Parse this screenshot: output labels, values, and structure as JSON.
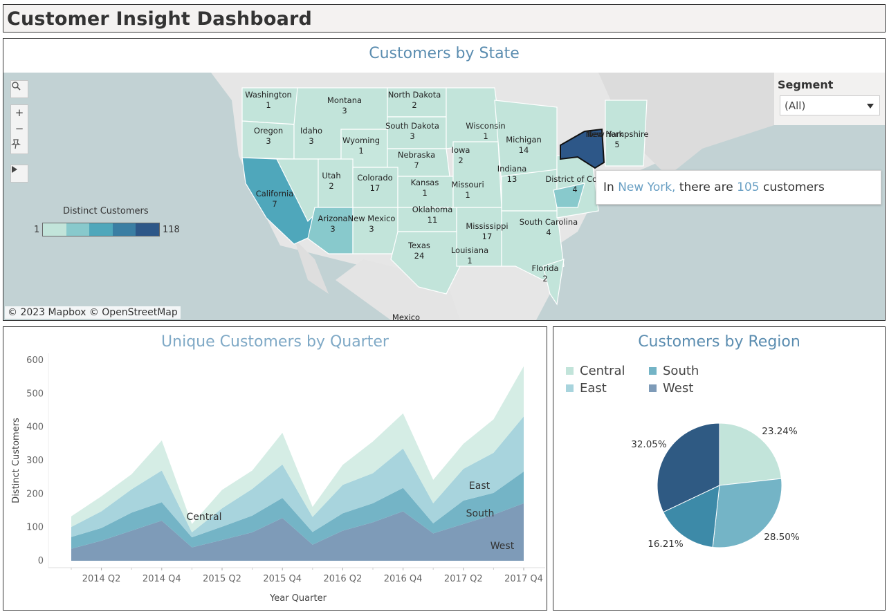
{
  "dashboard": {
    "title": "Customer Insight Dashboard"
  },
  "map": {
    "title": "Customers by State",
    "tools": {
      "search_icon": "magnifier",
      "zoom_in": "+",
      "zoom_out": "−",
      "pin_icon": "pin",
      "play_icon": "play"
    },
    "segment": {
      "label": "Segment",
      "selected": "(All)"
    },
    "tooltip": {
      "prefix": "In ",
      "state": "New York,",
      "middle": " there are ",
      "count": "105",
      "suffix": " customers"
    },
    "legend": {
      "title": "Distinct Customers",
      "min": "1",
      "max": "118",
      "colors": [
        "#c2e4da",
        "#88c9cc",
        "#4fa7bb",
        "#3a7ea3",
        "#2d5788"
      ]
    },
    "attribution": "© 2023 Mapbox © OpenStreetMap",
    "mexico_label": "Mexico",
    "states": [
      {
        "name": "Washington",
        "value": "1"
      },
      {
        "name": "Montana",
        "value": "3"
      },
      {
        "name": "North Dakota",
        "value": "2"
      },
      {
        "name": "Oregon",
        "value": "3"
      },
      {
        "name": "Idaho",
        "value": "3"
      },
      {
        "name": "Wyoming",
        "value": "1"
      },
      {
        "name": "South Dakota",
        "value": "3"
      },
      {
        "name": "Wisconsin",
        "value": "1"
      },
      {
        "name": "Michigan",
        "value": "14"
      },
      {
        "name": "New Hampshire",
        "value": "5"
      },
      {
        "name": "Iowa",
        "value": "2"
      },
      {
        "name": "Nebraska",
        "value": "7"
      },
      {
        "name": "Utah",
        "value": "2"
      },
      {
        "name": "Colorado",
        "value": "17"
      },
      {
        "name": "Kansas",
        "value": "1"
      },
      {
        "name": "Missouri",
        "value": "1"
      },
      {
        "name": "Indiana",
        "value": "13"
      },
      {
        "name": "District of Colu",
        "value": "4"
      },
      {
        "name": "California",
        "value": "7"
      },
      {
        "name": "Arizona",
        "value": "3"
      },
      {
        "name": "New Mexico",
        "value": "3"
      },
      {
        "name": "Oklahoma",
        "value": "11"
      },
      {
        "name": "Mississippi",
        "value": "17"
      },
      {
        "name": "South Carolina",
        "value": "4"
      },
      {
        "name": "Texas",
        "value": "24"
      },
      {
        "name": "Louisiana",
        "value": "1"
      },
      {
        "name": "Florida",
        "value": "2"
      },
      {
        "name": "New York",
        "value": ""
      }
    ]
  },
  "area_chart": {
    "title": "Unique Customers by Quarter",
    "ylabel": "Distinct Customers",
    "xlabel": "Year Quarter",
    "yticks": [
      "0",
      "100",
      "200",
      "300",
      "400",
      "500",
      "600"
    ],
    "xticks": [
      "2014 Q2",
      "2014 Q4",
      "2015 Q2",
      "2015 Q4",
      "2016 Q2",
      "2016 Q4",
      "2017 Q2",
      "2017 Q4"
    ],
    "series_labels": {
      "central": "Central",
      "east": "East",
      "south": "South",
      "west": "West"
    }
  },
  "pie": {
    "title": "Customers by Region",
    "legend": [
      {
        "name": "Central",
        "color": "#c2e4da"
      },
      {
        "name": "South",
        "color": "#74b4c6"
      },
      {
        "name": "East",
        "color": "#a8d4dd"
      },
      {
        "name": "West",
        "color": "#7e9bb8"
      }
    ],
    "labels": {
      "central": "23.24%",
      "south": "28.50%",
      "east": "16.21%",
      "west": "32.05%"
    }
  },
  "chart_data": [
    {
      "type": "area",
      "title": "Unique Customers by Quarter",
      "xlabel": "Year Quarter",
      "ylabel": "Distinct Customers",
      "ylim": [
        0,
        600
      ],
      "stacked": true,
      "x": [
        "2014 Q1",
        "2014 Q2",
        "2014 Q3",
        "2014 Q4",
        "2015 Q1",
        "2015 Q2",
        "2015 Q3",
        "2015 Q4",
        "2016 Q1",
        "2016 Q2",
        "2016 Q3",
        "2016 Q4",
        "2017 Q1",
        "2017 Q2",
        "2017 Q3",
        "2017 Q4"
      ],
      "series": [
        {
          "name": "West",
          "color": "#7e9bb8",
          "values": [
            36,
            60,
            90,
            120,
            40,
            62,
            85,
            128,
            48,
            90,
            115,
            148,
            82,
            110,
            138,
            172
          ]
        },
        {
          "name": "South",
          "color": "#74b4c6",
          "values": [
            35,
            38,
            54,
            55,
            30,
            40,
            50,
            60,
            38,
            52,
            57,
            70,
            30,
            70,
            65,
            95
          ]
        },
        {
          "name": "East",
          "color": "#a8d4dd",
          "values": [
            30,
            50,
            70,
            95,
            15,
            55,
            80,
            100,
            45,
            85,
            90,
            118,
            60,
            95,
            120,
            165
          ]
        },
        {
          "name": "Central",
          "color": "#d5ede5",
          "values": [
            32,
            45,
            45,
            90,
            25,
            55,
            55,
            95,
            30,
            60,
            95,
            105,
            70,
            75,
            100,
            150
          ]
        }
      ]
    },
    {
      "type": "pie",
      "title": "Customers by Region",
      "categories": [
        "Central",
        "South",
        "East",
        "West"
      ],
      "values": [
        23.24,
        28.5,
        16.21,
        32.05
      ],
      "colors": [
        "#c2e4da",
        "#74b4c6",
        "#3d8aa8",
        "#2f5a83"
      ]
    }
  ]
}
